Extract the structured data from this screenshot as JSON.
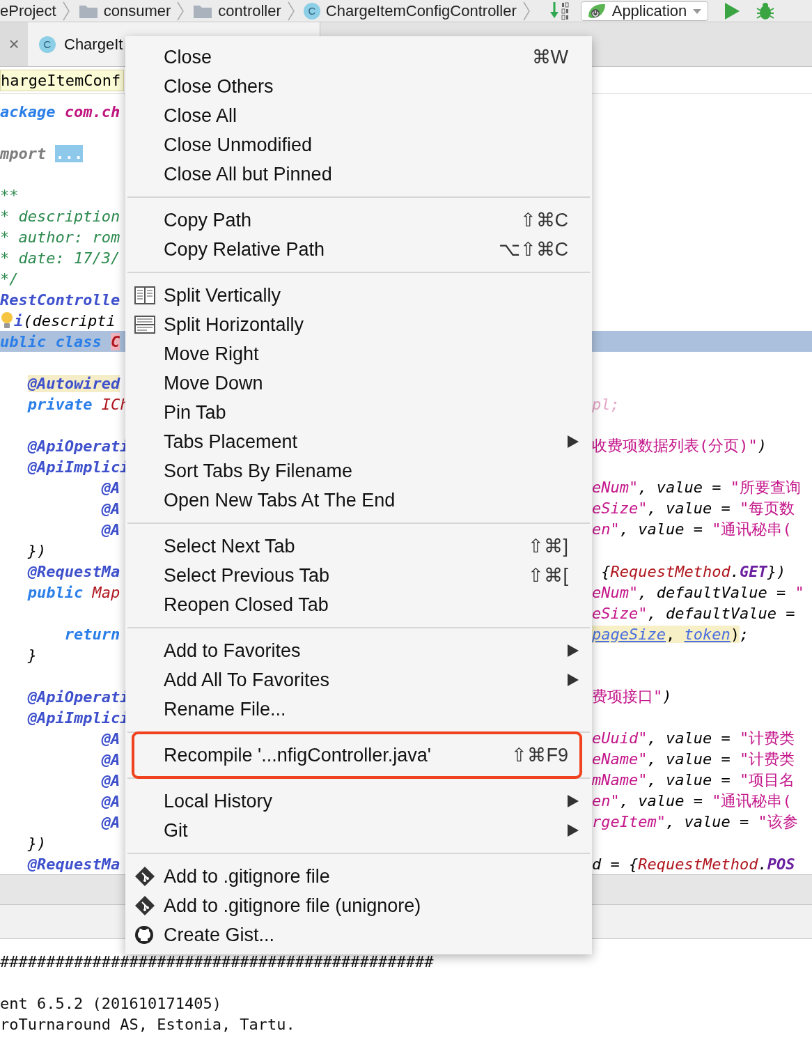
{
  "navbar": {
    "crumbs": [
      {
        "label": "eProject",
        "kind": "text"
      },
      {
        "label": "consumer",
        "kind": "folder"
      },
      {
        "label": "controller",
        "kind": "folder"
      },
      {
        "label": "ChargeItemConfigController",
        "kind": "class",
        "badge": "C"
      }
    ],
    "run_config": "Application"
  },
  "tabs": {
    "close_mark": "×",
    "items": [
      {
        "label": "ChargeIt",
        "badge": "C",
        "selected": true
      }
    ]
  },
  "editor": {
    "header": "hargeItemConf",
    "lines": [
      {
        "kind": "top",
        "left": [
          {
            "text": "ackage",
            "kind": "keyword"
          },
          {
            "text": " com.ch",
            "kind": "package"
          }
        ]
      },
      {
        "kind": "blank"
      },
      {
        "kind": "top",
        "left": [
          {
            "text": "mport",
            "kind": "folded"
          },
          {
            "text": "...",
            "kind": "fold"
          }
        ]
      },
      {
        "kind": "blank"
      },
      {
        "kind": "top",
        "left": [
          {
            "text": "**",
            "kind": "comment"
          }
        ]
      },
      {
        "kind": "top",
        "left": [
          {
            "text": "* description",
            "kind": "comment"
          }
        ]
      },
      {
        "kind": "top",
        "left": [
          {
            "text": "* author: rom",
            "kind": "comment"
          }
        ]
      },
      {
        "kind": "top",
        "left": [
          {
            "text": "* date: 17/3/",
            "kind": "comment"
          }
        ]
      },
      {
        "kind": "top",
        "left": [
          {
            "text": "*/",
            "kind": "comment"
          }
        ]
      },
      {
        "kind": "top",
        "left": [
          {
            "text": "RestControlle",
            "kind": "annotation"
          }
        ]
      },
      {
        "kind": "bulb",
        "left": [
          {
            "text": "i",
            "kind": "annotation"
          },
          {
            "text": "(descripti",
            "kind": "plain"
          }
        ]
      },
      {
        "kind": "top",
        "highlighted": true,
        "left": [
          {
            "text": "ublic class",
            "kind": "keyword"
          },
          {
            "text": "C",
            "kind": "error"
          }
        ]
      },
      {
        "kind": "blank"
      },
      {
        "kind": "member",
        "left": [
          {
            "text": "@Autowired",
            "kind": "marked"
          }
        ]
      },
      {
        "kind": "member",
        "left": [
          {
            "text": "private",
            "kind": "keyword"
          },
          {
            "text": " ICh",
            "kind": "type"
          }
        ],
        "right": [
          {
            "text": "pl;",
            "kind": "faint"
          }
        ]
      },
      {
        "kind": "blank"
      },
      {
        "kind": "member",
        "left": [
          {
            "text": "@ApiOperati",
            "kind": "annotation"
          }
        ],
        "right": [
          {
            "text": "收费项数据列表(分页)\"",
            "kind": "cjk"
          },
          {
            "text": ")",
            "kind": "plain"
          }
        ]
      },
      {
        "kind": "member",
        "left": [
          {
            "text": "@ApiImplici",
            "kind": "annotation"
          }
        ]
      },
      {
        "kind": "nested",
        "left": [
          {
            "text": "@A",
            "kind": "annotation"
          }
        ],
        "right": [
          {
            "text": "eNum\"",
            "kind": "string"
          },
          {
            "text": ", value = ",
            "kind": "plain"
          },
          {
            "text": "\"所要查询",
            "kind": "cjk"
          }
        ]
      },
      {
        "kind": "nested",
        "left": [
          {
            "text": "@A",
            "kind": "annotation"
          }
        ],
        "right": [
          {
            "text": "eSize\"",
            "kind": "string"
          },
          {
            "text": ", value = ",
            "kind": "plain"
          },
          {
            "text": "\"每页数",
            "kind": "cjk"
          }
        ]
      },
      {
        "kind": "nested",
        "left": [
          {
            "text": "@A",
            "kind": "annotation"
          }
        ],
        "right": [
          {
            "text": "en\"",
            "kind": "string"
          },
          {
            "text": ", value = ",
            "kind": "plain"
          },
          {
            "text": "\"通讯秘串(",
            "kind": "cjk"
          }
        ]
      },
      {
        "kind": "member",
        "left": [
          {
            "text": "})",
            "kind": "plain"
          }
        ]
      },
      {
        "kind": "member",
        "left": [
          {
            "text": "@RequestMa",
            "kind": "annotation"
          }
        ],
        "right": [
          {
            "text": " {",
            "kind": "plain"
          },
          {
            "text": "RequestMethod",
            "kind": "type"
          },
          {
            "text": ".",
            "kind": "plain"
          },
          {
            "text": "GET",
            "kind": "constant"
          },
          {
            "text": "})",
            "kind": "plain"
          }
        ]
      },
      {
        "kind": "member",
        "left": [
          {
            "text": "public",
            "kind": "keyword"
          },
          {
            "text": " Map",
            "kind": "type"
          }
        ],
        "right": [
          {
            "text": "eNum\"",
            "kind": "string"
          },
          {
            "text": ", defaultValue = ",
            "kind": "plain"
          },
          {
            "text": "\"",
            "kind": "string"
          }
        ]
      },
      {
        "kind": "member",
        "right": [
          {
            "text": "eSize\"",
            "kind": "string"
          },
          {
            "text": ", defaultValue =",
            "kind": "plain"
          }
        ]
      },
      {
        "kind": "body",
        "left": [
          {
            "text": "return",
            "kind": "keyword"
          }
        ],
        "right": [
          {
            "text": "pageSize",
            "kind": "param"
          },
          {
            "text": ", ",
            "kind": "shaded"
          },
          {
            "text": "token",
            "kind": "param"
          },
          {
            "text": ")",
            "kind": "shaded"
          },
          {
            "text": ";",
            "kind": "plain"
          }
        ]
      },
      {
        "kind": "member",
        "left": [
          {
            "text": "}",
            "kind": "plain"
          }
        ]
      },
      {
        "kind": "blank"
      },
      {
        "kind": "member",
        "left": [
          {
            "text": "@ApiOperati",
            "kind": "annotation"
          }
        ],
        "right": [
          {
            "text": "费项接口\"",
            "kind": "cjk"
          },
          {
            "text": ")",
            "kind": "plain"
          }
        ]
      },
      {
        "kind": "member",
        "left": [
          {
            "text": "@ApiImplici",
            "kind": "annotation"
          }
        ]
      },
      {
        "kind": "nested",
        "left": [
          {
            "text": "@A",
            "kind": "annotation"
          }
        ],
        "right": [
          {
            "text": "eUuid\"",
            "kind": "string"
          },
          {
            "text": ", value = ",
            "kind": "plain"
          },
          {
            "text": "\"计费类",
            "kind": "cjk"
          }
        ]
      },
      {
        "kind": "nested",
        "left": [
          {
            "text": "@A",
            "kind": "annotation"
          }
        ],
        "right": [
          {
            "text": "eName\"",
            "kind": "string"
          },
          {
            "text": ", value = ",
            "kind": "plain"
          },
          {
            "text": "\"计费类",
            "kind": "cjk"
          }
        ]
      },
      {
        "kind": "nested",
        "left": [
          {
            "text": "@A",
            "kind": "annotation"
          }
        ],
        "right": [
          {
            "text": "mName\"",
            "kind": "string"
          },
          {
            "text": ", value = ",
            "kind": "plain"
          },
          {
            "text": "\"项目名",
            "kind": "cjk"
          }
        ]
      },
      {
        "kind": "nested",
        "left": [
          {
            "text": "@A",
            "kind": "annotation"
          }
        ],
        "right": [
          {
            "text": "en\"",
            "kind": "string"
          },
          {
            "text": ", value = ",
            "kind": "plain"
          },
          {
            "text": "\"通讯秘串(",
            "kind": "cjk"
          }
        ]
      },
      {
        "kind": "nested",
        "left": [
          {
            "text": "@A",
            "kind": "annotation"
          }
        ],
        "right": [
          {
            "text": "rgeItem\"",
            "kind": "string"
          },
          {
            "text": ", value = ",
            "kind": "plain"
          },
          {
            "text": "\"该参",
            "kind": "cjk"
          }
        ]
      },
      {
        "kind": "member",
        "left": [
          {
            "text": "})",
            "kind": "plain"
          }
        ]
      },
      {
        "kind": "member",
        "left": [
          {
            "text": "@RequestMa",
            "kind": "annotation"
          }
        ],
        "right": [
          {
            "text": "d = {",
            "kind": "plain"
          },
          {
            "text": "RequestMethod",
            "kind": "type"
          },
          {
            "text": ".",
            "kind": "plain"
          },
          {
            "text": "POS",
            "kind": "constant"
          }
        ]
      }
    ]
  },
  "console": {
    "lines": [
      "###############################################",
      "ent 6.5.2 (201610171405)",
      "roTurnaround AS, Estonia, Tartu."
    ]
  },
  "context_menu": {
    "groups": [
      [
        {
          "label": "Close",
          "shortcut": "⌘W",
          "kind": "plain",
          "outlined": false
        },
        {
          "label": "Close Others",
          "kind": "plain",
          "outlined": false
        },
        {
          "label": "Close All",
          "kind": "plain",
          "outlined": false
        },
        {
          "label": "Close Unmodified",
          "kind": "plain",
          "outlined": false
        },
        {
          "label": "Close All but Pinned",
          "kind": "plain",
          "outlined": false
        }
      ],
      [
        {
          "label": "Copy Path",
          "shortcut": "⇧⌘C",
          "kind": "plain",
          "outlined": false
        },
        {
          "label": "Copy Relative Path",
          "shortcut": "⌥⇧⌘C",
          "kind": "plain",
          "outlined": false
        }
      ],
      [
        {
          "label": "Split Vertically",
          "kind": "vsplit",
          "outlined": false
        },
        {
          "label": "Split Horizontally",
          "kind": "hsplit",
          "outlined": false
        },
        {
          "label": "Move Right",
          "kind": "plain",
          "outlined": false
        },
        {
          "label": "Move Down",
          "kind": "plain",
          "outlined": false
        },
        {
          "label": "Pin Tab",
          "kind": "plain",
          "outlined": false
        },
        {
          "label": "Tabs Placement",
          "kind": "submenu",
          "outlined": false
        },
        {
          "label": "Sort Tabs By Filename",
          "kind": "plain",
          "outlined": false
        },
        {
          "label": "Open New Tabs At The End",
          "kind": "plain",
          "outlined": false
        }
      ],
      [
        {
          "label": "Select Next Tab",
          "shortcut": "⇧⌘]",
          "kind": "plain",
          "outlined": false
        },
        {
          "label": "Select Previous Tab",
          "shortcut": "⇧⌘[",
          "kind": "plain",
          "outlined": false
        },
        {
          "label": "Reopen Closed Tab",
          "kind": "plain",
          "outlined": false
        }
      ],
      [
        {
          "label": "Add to Favorites",
          "kind": "submenu",
          "outlined": false
        },
        {
          "label": "Add All To Favorites",
          "kind": "submenu",
          "outlined": false
        },
        {
          "label": "Rename File...",
          "kind": "plain",
          "outlined": false
        }
      ],
      [
        {
          "label": "Recompile '...nfigController.java'",
          "shortcut": "⇧⌘F9",
          "kind": "plain",
          "outlined": true
        }
      ],
      [
        {
          "label": "Local History",
          "kind": "submenu",
          "outlined": false
        },
        {
          "label": "Git",
          "kind": "submenu",
          "outlined": false
        }
      ],
      [
        {
          "label": "Add to .gitignore file",
          "kind": "git",
          "outlined": false
        },
        {
          "label": "Add to .gitignore file (unignore)",
          "kind": "git",
          "outlined": false
        },
        {
          "label": "Create Gist...",
          "kind": "github",
          "outlined": false
        }
      ]
    ]
  }
}
